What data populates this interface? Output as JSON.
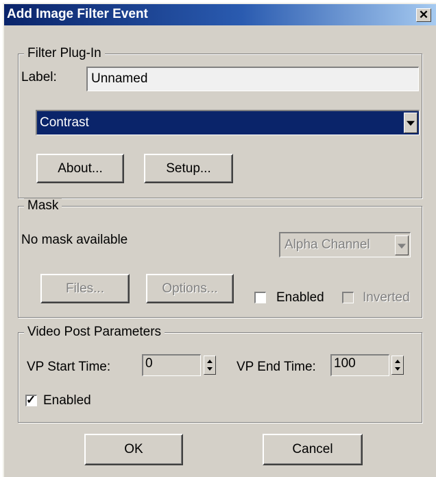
{
  "window": {
    "title": "Add Image Filter Event",
    "close_glyph": "✕"
  },
  "filter_plugin": {
    "group_label": "Filter Plug-In",
    "label_caption": "Label:",
    "label_value": "Unnamed",
    "selected_filter": "Contrast",
    "about_label": "About...",
    "setup_label": "Setup..."
  },
  "mask": {
    "group_label": "Mask",
    "status_text": "No mask available",
    "channel_value": "Alpha Channel",
    "files_label": "Files...",
    "options_label": "Options...",
    "enabled_label": "Enabled",
    "enabled_checked": false,
    "inverted_label": "Inverted",
    "inverted_checked": false
  },
  "video_post": {
    "group_label": "Video Post Parameters",
    "start_caption": "VP Start Time:",
    "start_value": "0",
    "end_caption": "VP End Time:",
    "end_value": "100",
    "enabled_label": "Enabled",
    "enabled_checked": true,
    "check_glyph": "✓"
  },
  "footer": {
    "ok_label": "OK",
    "cancel_label": "Cancel"
  },
  "colors": {
    "dialog_face": "#d4d0c8",
    "title_gradient_start": "#0a246a",
    "title_gradient_end": "#a6caf0",
    "selection_bg": "#0a246a"
  },
  "icons": {
    "close": "close-icon",
    "dropdown": "chevron-down-icon",
    "spinner": "spinner-arrows-icon",
    "check": "check-icon"
  }
}
